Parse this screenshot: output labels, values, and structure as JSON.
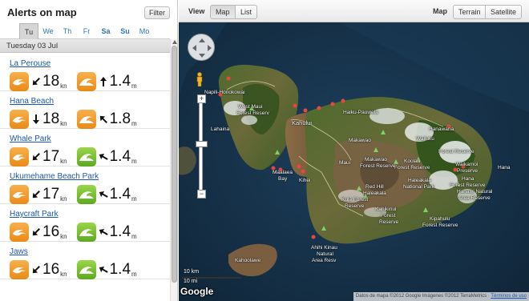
{
  "panel": {
    "title": "Alerts on map",
    "filter_label": "Filter",
    "days": [
      "Tu",
      "We",
      "Th",
      "Fr",
      "Sa",
      "Su",
      "Mo"
    ],
    "selected_day": "Tu",
    "date_label": "Tuesday 03 Jul"
  },
  "spots": [
    {
      "name": "La Perouse",
      "wind": "18",
      "wind_unit": "kn",
      "wave": "1.4",
      "wave_unit": "m",
      "wind_icon": "wind-icon",
      "wave_icon": "wave-icon",
      "wave_color": "orange"
    },
    {
      "name": "Hana Beach",
      "wind": "18",
      "wind_unit": "kn",
      "wave": "1.8",
      "wave_unit": "m",
      "wind_icon": "wind-icon",
      "wave_icon": "wave-icon",
      "wave_color": "orange"
    },
    {
      "name": "Whale Park",
      "wind": "17",
      "wind_unit": "kn",
      "wave": "1.4",
      "wave_unit": "m",
      "wind_icon": "wind-icon",
      "wave_icon": "wave-icon",
      "wave_color": "green"
    },
    {
      "name": "Ukumehame Beach Park",
      "wind": "17",
      "wind_unit": "kn",
      "wave": "1.4",
      "wave_unit": "m",
      "wind_icon": "wind-icon",
      "wave_icon": "wave-icon",
      "wave_color": "green"
    },
    {
      "name": "Haycraft Park",
      "wind": "16",
      "wind_unit": "kn",
      "wave": "1.4",
      "wave_unit": "m",
      "wind_icon": "wind-icon",
      "wave_icon": "wave-icon",
      "wave_color": "green"
    },
    {
      "name": "Jaws",
      "wind": "16",
      "wind_unit": "kn",
      "wave": "1.4",
      "wave_unit": "m",
      "wind_icon": "wind-icon",
      "wave_icon": "wave-icon",
      "wave_color": "green"
    }
  ],
  "map": {
    "view_label": "View",
    "view_buttons": [
      "Map",
      "List"
    ],
    "selected_view": "Map",
    "map_label": "Map",
    "map_types": [
      "Terrain",
      "Satellite"
    ],
    "places": {
      "napili": "Napili-Honokowai",
      "west_maui_1": "West Maui",
      "west_maui_2": "Forest Reserv",
      "kahului": "Kahului",
      "haiku": "Haiku-Pauwela",
      "lahaina": "Lahaina",
      "makawao": "Makawao",
      "koolau_1": "Koolau",
      "koolau_2": "Forest Reserve",
      "wailuku": "Wailuku",
      "hanawana_1": "Hanawana",
      "hanawana_2": "Forest Reserve",
      "maui": "Maui",
      "makawao_fr_1": "Makawao",
      "makawao_fr_2": "Forest Reserve",
      "waikamoi_1": "Waikamoi",
      "waikamoi_2": "Preserve",
      "hana_fr_1": "Hana",
      "hana_fr_2": "Forest Reserve",
      "hana": "Hana",
      "maalaea_1": "Maalaea",
      "maalaea_2": "Bay",
      "kihei": "Kihei",
      "haleakala_1": "Haleakala",
      "haleakala_2": "National Park",
      "hanawi_1": "Hanawi Natural",
      "hanawi_2": "Area Reserve",
      "red_hill_1": "Red Hill",
      "red_hill_2": "Haleakala",
      "kula_1": "Kula Forest",
      "kula_2": "Reserve",
      "kahikinui_1": "Kahikinui",
      "kahikinui_2": "Forest",
      "kahikinui_3": "Reserve",
      "kipahulu_1": "Kipahulu",
      "kipahulu_2": "Forest Reserve",
      "ahihi_1": "Ahihi Kinau",
      "ahihi_2": "Natural",
      "ahihi_3": "Area Resv",
      "kahoolawe": "Kahoolawe"
    },
    "scale_km": "10 km",
    "scale_mi": "10 mi",
    "logo": "Google",
    "attribution": "Datos de mapa ©2012 Google Imágenes ©2012 TerraMetrics · ",
    "terms": "Términos de uso"
  }
}
